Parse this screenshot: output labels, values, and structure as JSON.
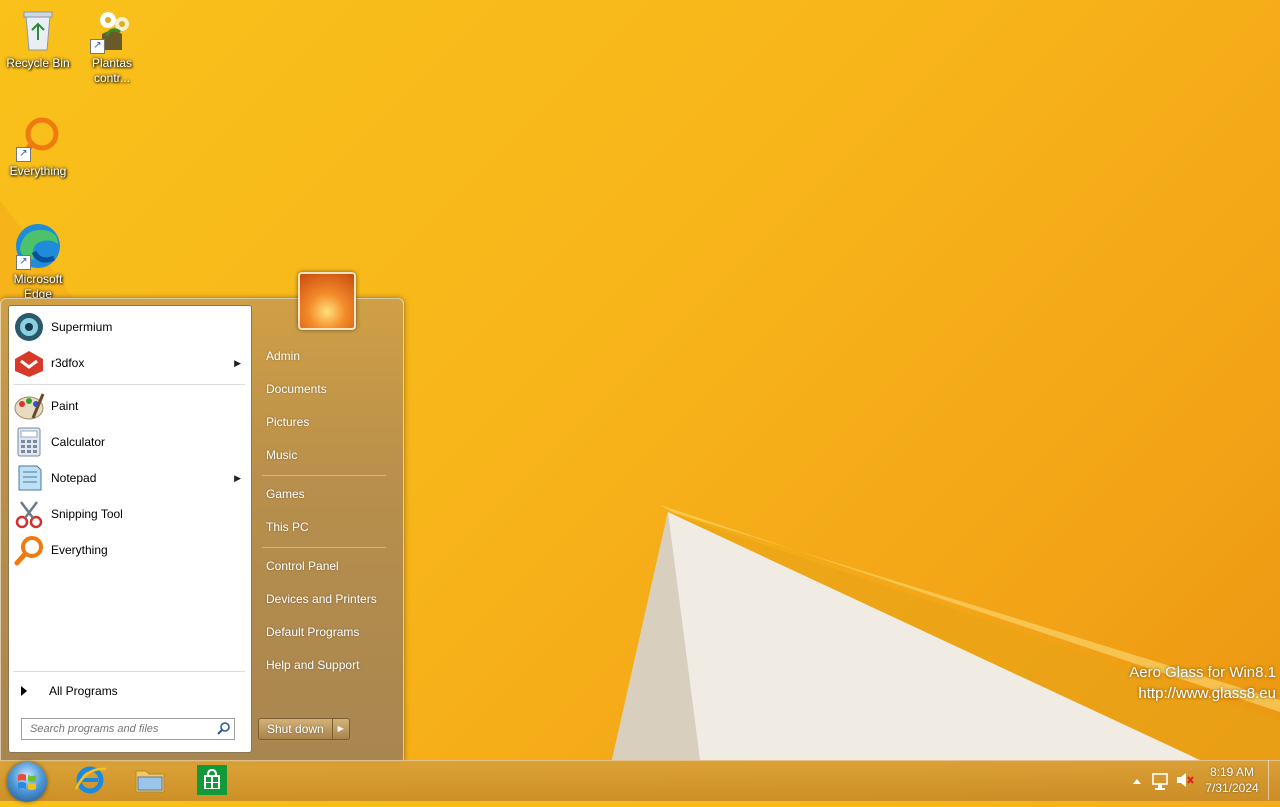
{
  "desktop": {
    "icons": [
      {
        "label": "Recycle Bin"
      },
      {
        "label": "Plantas contr..."
      },
      {
        "label": "Everything"
      },
      {
        "label": "Microsoft Edge"
      }
    ],
    "watermark": {
      "line1": "Aero Glass for Win8.1",
      "line2": "http://www.glass8.eu"
    }
  },
  "start_menu": {
    "pinned": [
      {
        "label": "Supermium",
        "icon": "supermium-icon"
      },
      {
        "label": "r3dfox",
        "icon": "r3dfox-icon",
        "has_submenu": true
      }
    ],
    "recent": [
      {
        "label": "Paint",
        "icon": "paint-icon"
      },
      {
        "label": "Calculator",
        "icon": "calculator-icon"
      },
      {
        "label": "Notepad",
        "icon": "notepad-icon",
        "has_submenu": true
      },
      {
        "label": "Snipping Tool",
        "icon": "snipping-tool-icon"
      },
      {
        "label": "Everything",
        "icon": "everything-icon"
      }
    ],
    "all_programs": "All Programs",
    "search_placeholder": "Search programs and files",
    "right_items": [
      "Admin",
      "Documents",
      "Pictures",
      "Music",
      "Games",
      "This PC",
      "Control Panel",
      "Devices and Printers",
      "Default Programs",
      "Help and Support"
    ],
    "shutdown_label": "Shut down"
  },
  "taskbar": {
    "pinned": [
      "internet-explorer-icon",
      "file-explorer-icon",
      "store-icon"
    ],
    "clock": {
      "time": "8:19 AM",
      "date": "7/31/2024"
    }
  }
}
